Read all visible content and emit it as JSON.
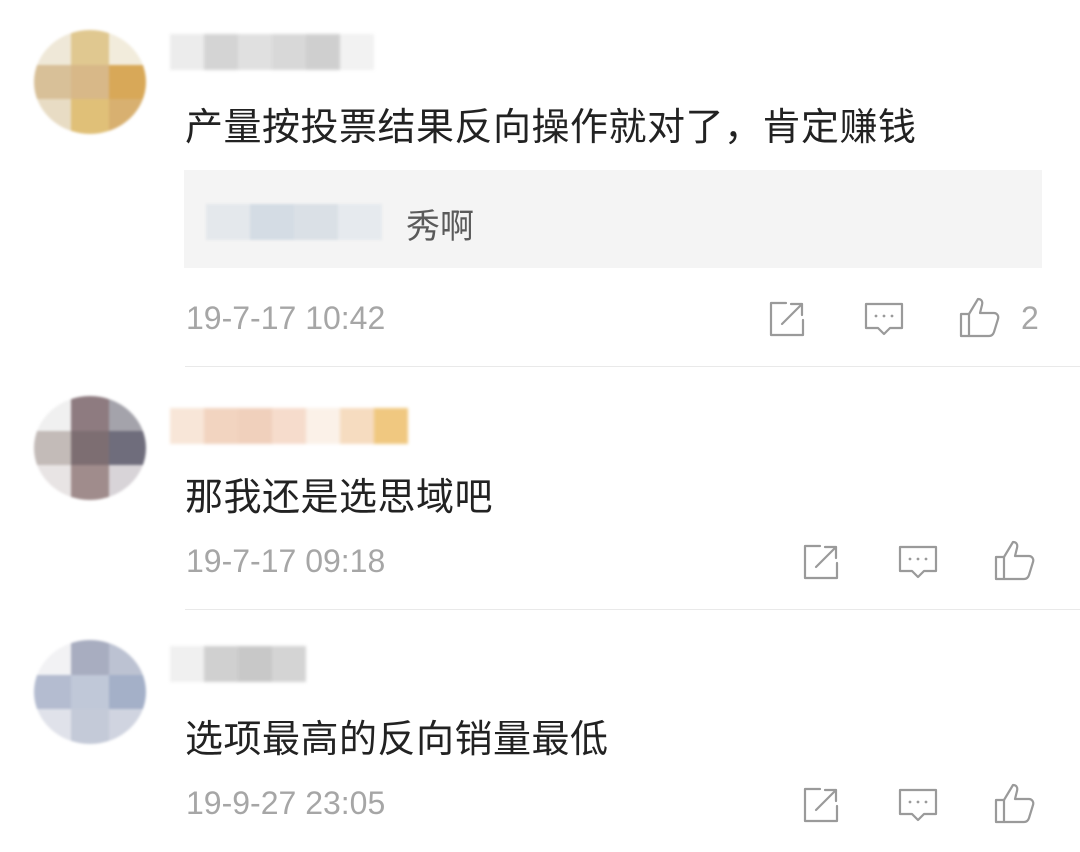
{
  "comments": [
    {
      "text": "产量按投票结果反向操作就对了，肯定赚钱",
      "reply": {
        "text": "秀啊"
      },
      "timestamp": "19-7-17 10:42",
      "likes": "2"
    },
    {
      "text": "那我还是选思域吧",
      "timestamp": "19-7-17 09:18"
    },
    {
      "text": "选项最高的反向销量最低",
      "timestamp": "19-9-27 23:05"
    }
  ],
  "icons": {
    "share": "share-icon",
    "reply": "comment-icon",
    "like": "thumbs-up-icon"
  },
  "colors": {
    "text": "#222222",
    "meta": "#a6a6a6",
    "reply_bg": "#f4f4f4",
    "divider": "#e9e9e9"
  }
}
